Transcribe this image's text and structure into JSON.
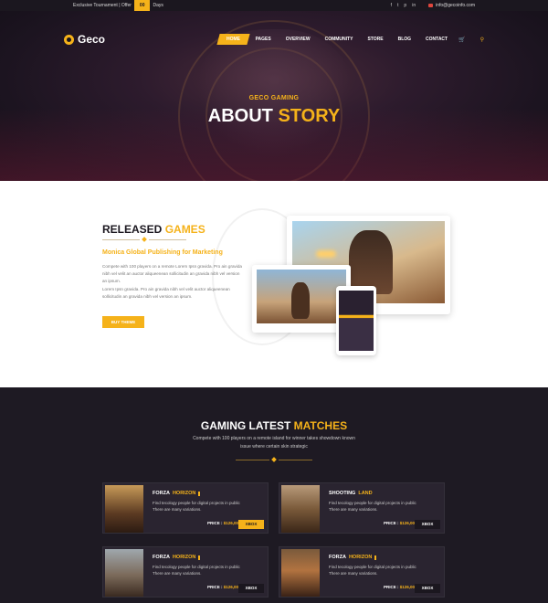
{
  "topbar": {
    "promo_text": "Exclusive Tournament | Offer",
    "days_count": "00",
    "days_label": "Days",
    "socials": [
      "f",
      "t",
      "p",
      "in"
    ],
    "email": "info@gecoinfo.com"
  },
  "header": {
    "logo_text": "Geco",
    "nav": [
      "HOME",
      "PAGES",
      "OVERVIEW",
      "COMMUNITY",
      "STORE",
      "BLOG",
      "CONTACT"
    ],
    "cart_count": "0"
  },
  "hero": {
    "subtitle": "GECO GAMING",
    "title_main": "ABOUT",
    "title_accent": "STORY"
  },
  "released": {
    "title_main": "RELEASED",
    "title_accent": "GAMES",
    "subtitle": "Monica Global Publishing for Marketing",
    "para1": "Compete with 100 players on a remote Lorem Ipsn gravida. Pro ain gravida nibh vel velit an auctor aliqueenean sollicitudin an gravida nibh vel version an ipsum.",
    "para2": "Lorem Ipsn gravida. Pro ain gravida nibh vel velit auctor aliqueenean sollicitudin an gravida nibh vel version an ipsum.",
    "button": "BUY THEME"
  },
  "matches": {
    "title_main": "GAMING LATEST",
    "title_accent": "MATCHES",
    "description": "Compete with 100 players on a remote island for winner takes showdown known issue where certain skin strategic",
    "cards": [
      {
        "title_main": "FORZA",
        "title_accent": "HORIZON",
        "desc1": "Find tecology people for digital projects in public",
        "desc2": "There are many variations.",
        "price_label": "PRICE :",
        "price": "$126,00",
        "platform": "XBOX"
      },
      {
        "title_main": "SHOOTING",
        "title_accent": "LAND",
        "desc1": "Find tecology people for digital projects in public",
        "desc2": "There are many variations.",
        "price_label": "PRICE :",
        "price": "$126,00",
        "platform": "XBOX"
      },
      {
        "title_main": "FORZA",
        "title_accent": "HORIZON",
        "desc1": "Find tecology people for digital projects in public",
        "desc2": "There are many variations.",
        "price_label": "PRICE :",
        "price": "$126,00",
        "platform": "XBOX"
      },
      {
        "title_main": "FORZA",
        "title_accent": "HORIZON",
        "desc1": "Find tecology people for digital projects in public",
        "desc2": "There are many variations.",
        "price_label": "PRICE :",
        "price": "$126,00",
        "platform": "XBOX"
      }
    ]
  },
  "colors": {
    "accent": "#f5b21a",
    "dark_bg": "#1e1a23",
    "card_bg": "#2a2430"
  }
}
